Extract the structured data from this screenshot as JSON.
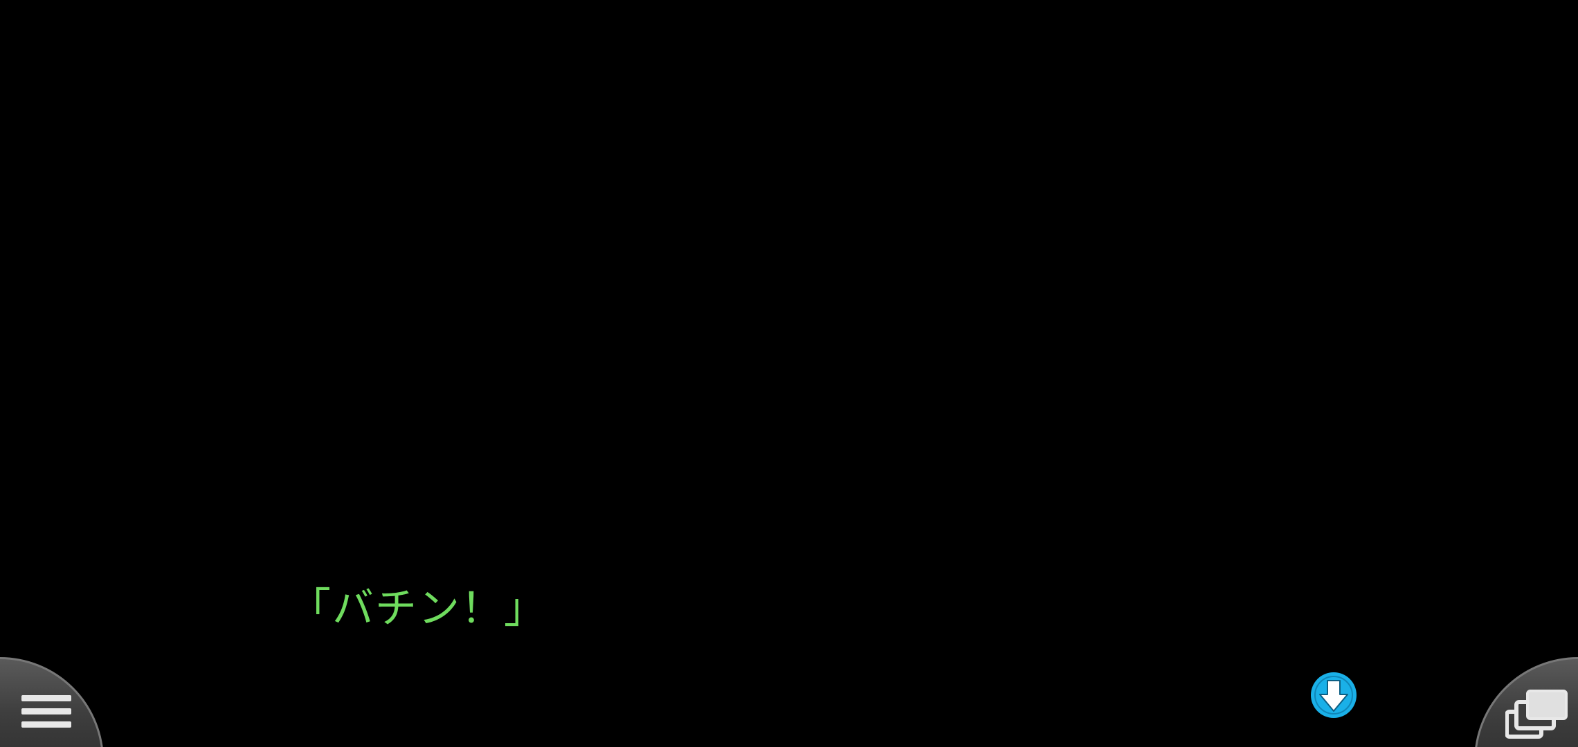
{
  "dialogue": {
    "text": "「バチン！」",
    "color": "#6fdc5e"
  },
  "controls": {
    "advance_icon": "down-arrow-circle-icon",
    "advance_color": "#1ab0e8",
    "menu_icon": "hamburger-menu-icon",
    "backlog_icon": "stacked-windows-icon"
  }
}
